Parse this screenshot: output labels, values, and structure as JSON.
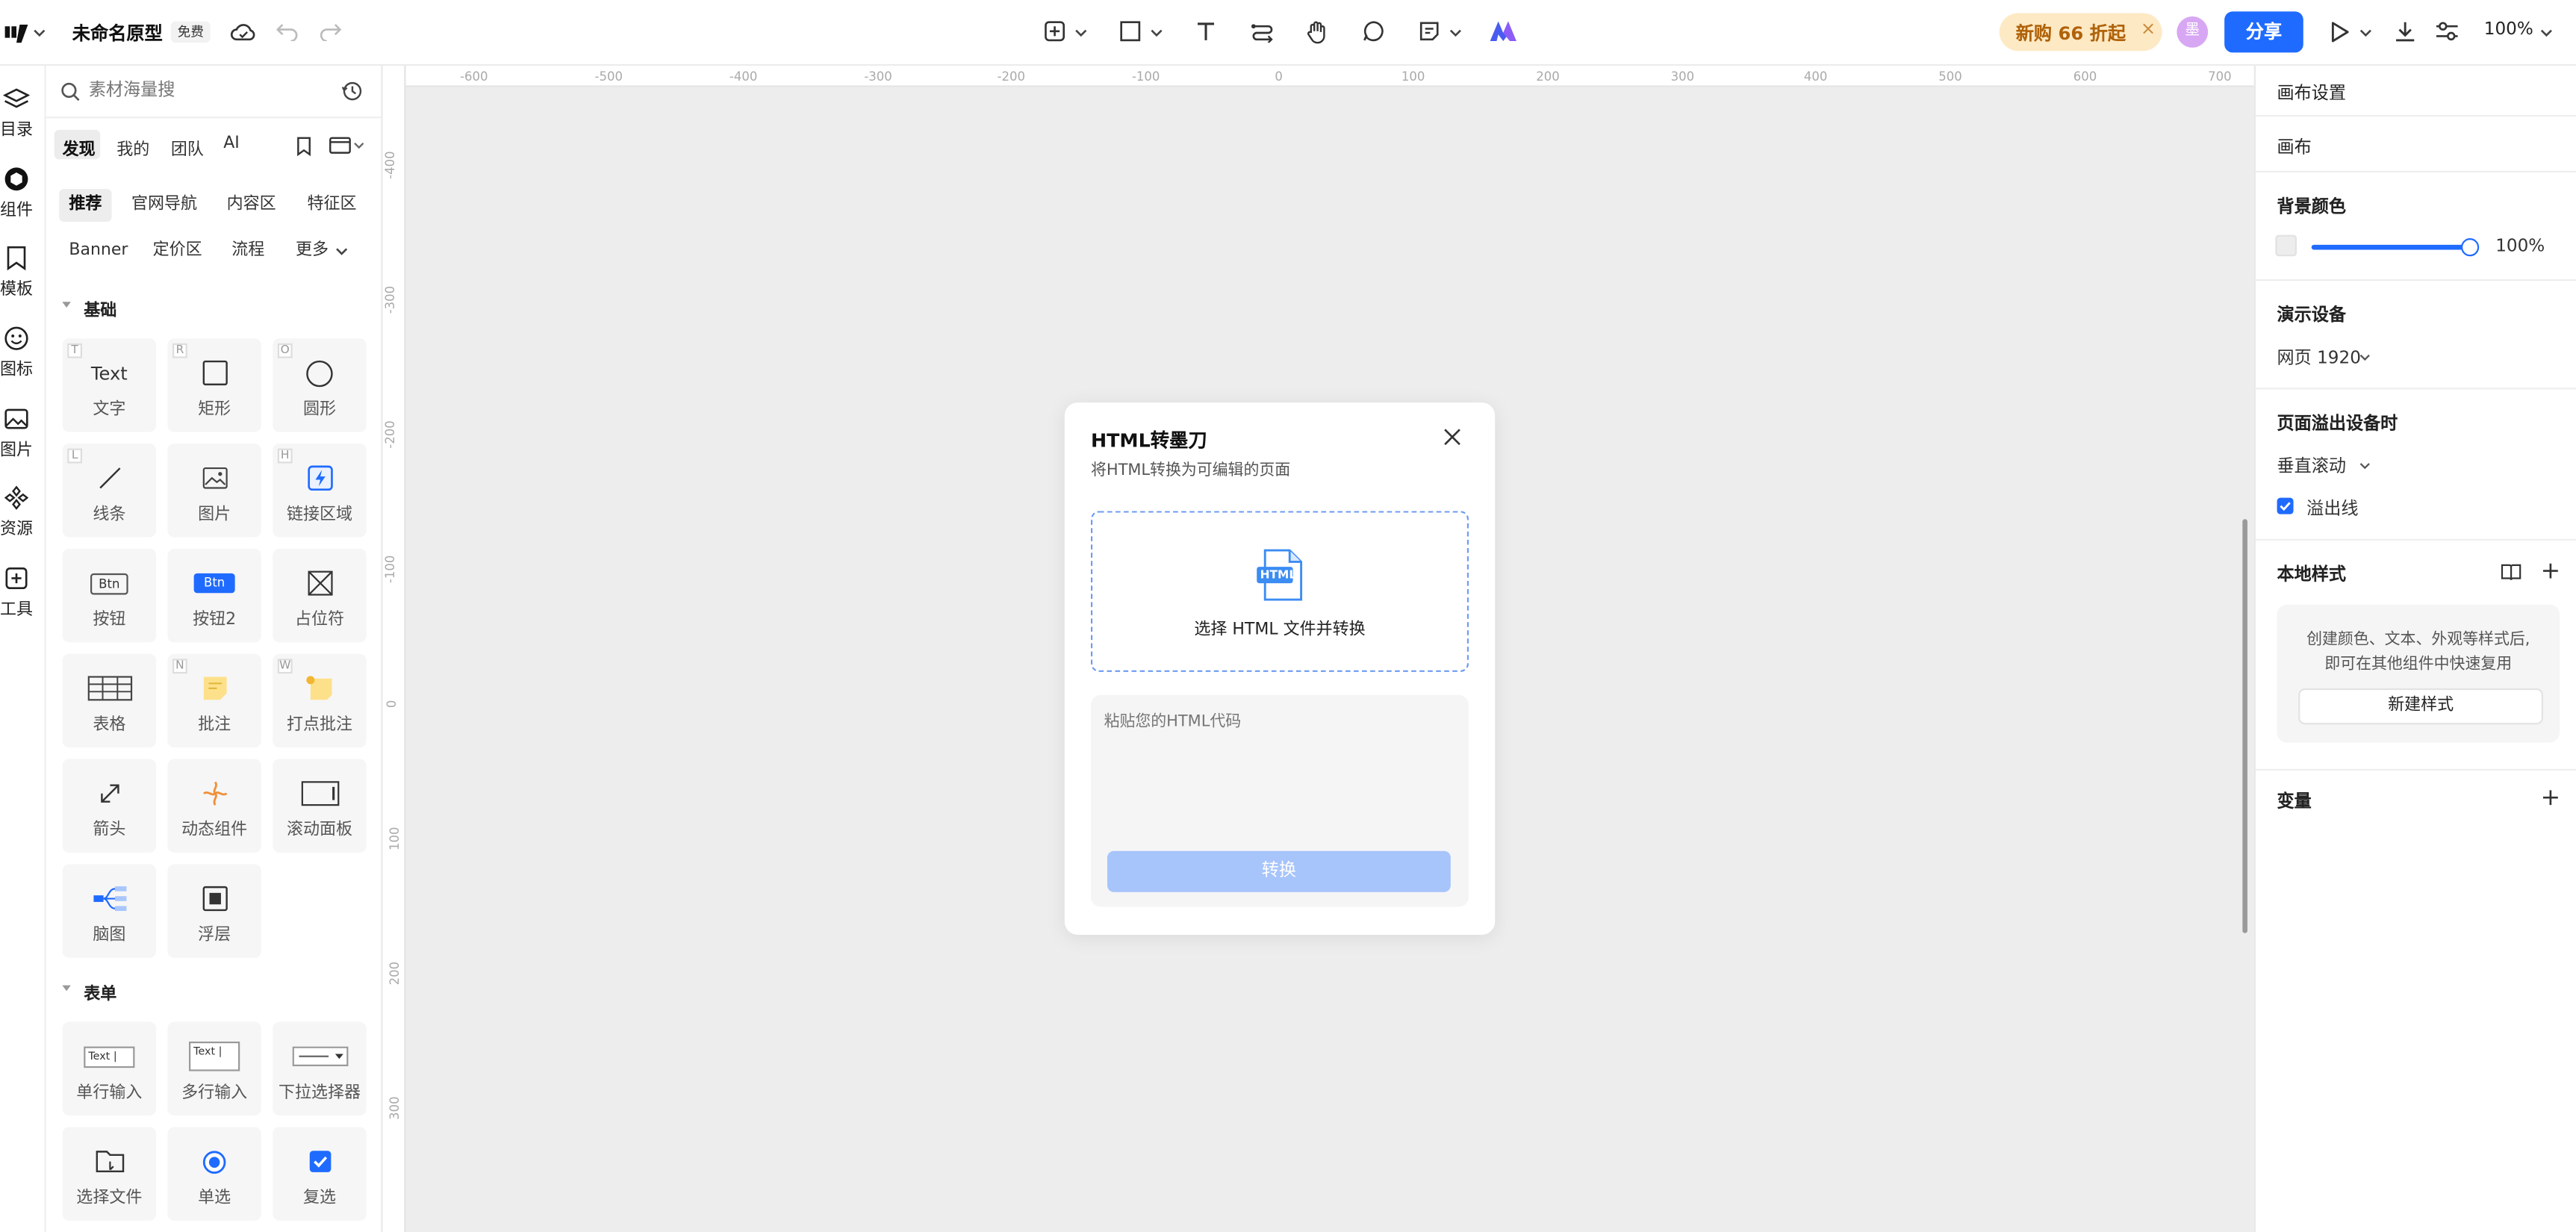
{
  "topbar": {
    "logo": "墨刀",
    "doc_title": "未命名原型",
    "free_badge": "免费",
    "promo_label": "新购 66 折起",
    "share_label": "分享",
    "zoom_value": "100%"
  },
  "rail": [
    {
      "label": "目录",
      "icon": "layers-icon"
    },
    {
      "label": "组件",
      "icon": "component-icon"
    },
    {
      "label": "模板",
      "icon": "template-icon"
    },
    {
      "label": "图标",
      "icon": "smile-icon"
    },
    {
      "label": "图片",
      "icon": "image-icon"
    },
    {
      "label": "资源",
      "icon": "resource-icon"
    },
    {
      "label": "工具",
      "icon": "tools-icon"
    }
  ],
  "library": {
    "search_placeholder": "素材海量搜",
    "tabs": [
      "发现",
      "我的",
      "团队",
      "AI"
    ],
    "chips_row1": [
      "推荐",
      "官网导航",
      "内容区",
      "特征区"
    ],
    "chips_row2": [
      "Banner",
      "定价区",
      "流程",
      "更多"
    ],
    "section_basic": "基础",
    "basic_items": [
      {
        "label": "文字",
        "glyph": "Text",
        "key": "T"
      },
      {
        "label": "矩形",
        "key": "R"
      },
      {
        "label": "圆形",
        "key": "O"
      },
      {
        "label": "线条",
        "key": "L"
      },
      {
        "label": "图片",
        "key": ""
      },
      {
        "label": "链接区域",
        "key": "H"
      },
      {
        "label": "按钮",
        "glyph": "Btn",
        "key": ""
      },
      {
        "label": "按钮2",
        "glyph": "Btn",
        "key": ""
      },
      {
        "label": "占位符",
        "key": ""
      },
      {
        "label": "表格",
        "key": ""
      },
      {
        "label": "批注",
        "key": "N"
      },
      {
        "label": "打点批注",
        "key": "W"
      },
      {
        "label": "箭头",
        "key": ""
      },
      {
        "label": "动态组件",
        "key": ""
      },
      {
        "label": "滚动面板",
        "key": ""
      },
      {
        "label": "脑图",
        "key": ""
      },
      {
        "label": "浮层",
        "key": ""
      }
    ],
    "section_form": "表单",
    "form_items": [
      {
        "label": "单行输入",
        "glyph": "Text |"
      },
      {
        "label": "多行输入",
        "glyph": "Text |"
      },
      {
        "label": "下拉选择器"
      },
      {
        "label": "选择文件"
      },
      {
        "label": "单选"
      },
      {
        "label": "复选"
      }
    ]
  },
  "ruler": {
    "h_ticks": [
      "-600",
      "-500",
      "-400",
      "-300",
      "-200",
      "-100",
      "0",
      "100",
      "200",
      "300",
      "400",
      "500",
      "600",
      "700"
    ],
    "v_ticks": [
      "-400",
      "-300",
      "-200",
      "-100",
      "0",
      "100",
      "200",
      "300"
    ]
  },
  "dialog": {
    "title": "HTML转墨刀",
    "subtitle": "将HTML转换为可编辑的页面",
    "file_badge": "HTML",
    "upload_label": "选择 HTML 文件并转换",
    "code_placeholder": "粘贴您的HTML代码",
    "convert_label": "转换"
  },
  "inspector": {
    "canvas_settings": "画布设置",
    "canvas": "画布",
    "bg_color_title": "背景颜色",
    "bg_opacity": "100%",
    "bg_opacity_fraction": 1.0,
    "device_title": "演示设备",
    "device_value": "网页 1920",
    "overflow_title": "页面溢出设备时",
    "overflow_value": "垂直滚动",
    "overflow_line_label": "溢出线",
    "overflow_line_checked": true,
    "local_styles_title": "本地样式",
    "local_styles_desc_1": "创建颜色、文本、外观等样式后,",
    "local_styles_desc_2": "即可在其他组件中快速复用",
    "new_style_label": "新建样式",
    "variables_title": "变量"
  },
  "colors": {
    "accent": "#1f6bff",
    "promo_bg": "#fde9c4",
    "promo_text": "#b0620a",
    "avatar": "#d8a7f3",
    "convert_disabled": "#a7c4fb",
    "canvas_bg": "#ededee"
  }
}
